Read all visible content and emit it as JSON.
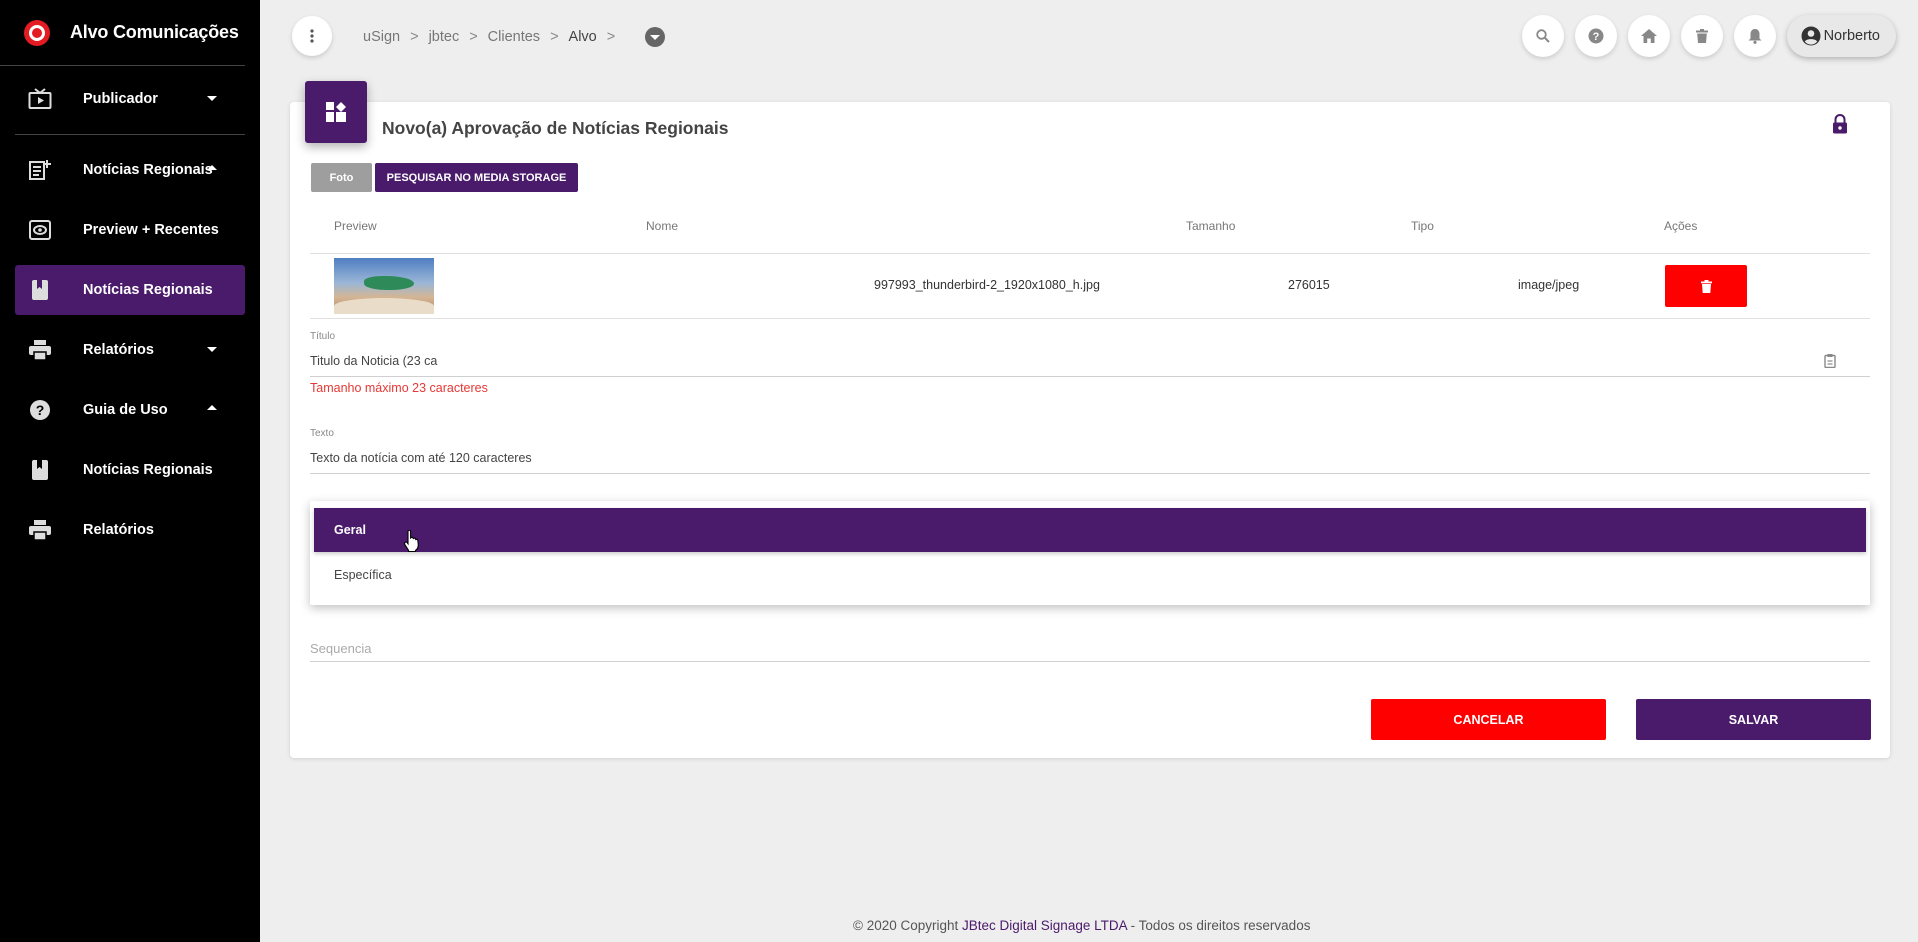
{
  "sidebar": {
    "brand": "Alvo Comunicações",
    "items": [
      {
        "label": "Publicador",
        "icon": "tv-play-icon",
        "caret": "down"
      },
      {
        "label": "Notícias Regionais",
        "icon": "news-add-icon",
        "caret": "up"
      },
      {
        "label": "Preview + Recentes",
        "icon": "eye-icon"
      },
      {
        "label": "Notícias Regionais",
        "icon": "book-icon",
        "active": true
      },
      {
        "label": "Relatórios",
        "icon": "printer-icon",
        "caret": "down"
      },
      {
        "label": "Guia de Uso",
        "icon": "help-icon",
        "caret": "up"
      },
      {
        "label": "Notícias Regionais",
        "icon": "book-icon"
      },
      {
        "label": "Relatórios",
        "icon": "printer-icon"
      }
    ]
  },
  "breadcrumb": [
    "uSign",
    "jbtec",
    "Clientes",
    "Alvo"
  ],
  "breadcrumb_sep": ">",
  "user": {
    "name": "Norberto"
  },
  "form": {
    "title": "Novo(a) Aprovação de Notícias Regionais",
    "foto_button": "Foto",
    "media_button": "PESQUISAR NO MEDIA STORAGE",
    "table": {
      "columns": [
        "Preview",
        "Nome",
        "Tamanho",
        "Tipo",
        "Ações"
      ],
      "row": {
        "nome": "997993_thunderbird-2_1920x1080_h.jpg",
        "tamanho": "276015",
        "tipo": "image/jpeg"
      }
    },
    "titulo": {
      "label": "Título",
      "value": "Titulo da Noticia (23 ca",
      "error": "Tamanho máximo 23 caracteres"
    },
    "texto": {
      "label": "Texto",
      "value": "Texto da notícia com até 120 caracteres"
    },
    "dropdown": {
      "options": [
        "Geral",
        "Específica"
      ],
      "selected": "Geral"
    },
    "sequencia": {
      "placeholder": "Sequencia"
    },
    "cancel": "CANCELAR",
    "save": "SALVAR"
  },
  "footer": {
    "prefix": "© 2020 Copyright ",
    "company": "JBtec Digital Signage LTDA",
    "suffix": " - Todos os direitos reservados"
  },
  "colors": {
    "accent": "#4a1a6b",
    "danger": "#ff0000",
    "sidebar": "#000000",
    "brand_logo": "#e31b23"
  }
}
